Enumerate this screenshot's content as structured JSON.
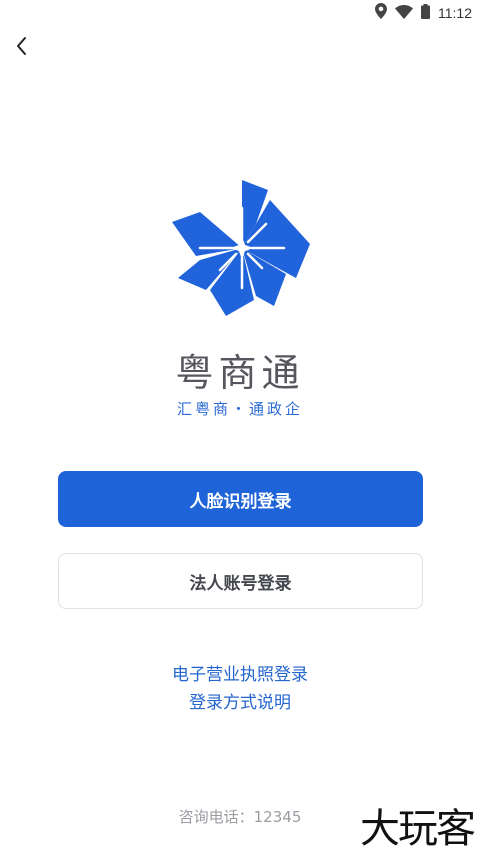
{
  "status_bar": {
    "time": "11:12",
    "icons": [
      "location-icon",
      "wifi-icon",
      "battery-icon"
    ]
  },
  "nav": {
    "back_icon": "chevron-left-icon"
  },
  "brand": {
    "app_name": "粤商通",
    "slogan": "汇粤商・通政企",
    "logo_color": "#2063db"
  },
  "buttons": {
    "face_login": "人脸识别登录",
    "account_login": "法人账号登录"
  },
  "links": {
    "license_login": "电子营业执照登录",
    "login_help": "登录方式说明"
  },
  "footer": {
    "hotline": "咨询电话：12345",
    "watermark": "大玩客"
  },
  "colors": {
    "primary": "#1f63d8",
    "link": "#2465cf",
    "text_dark": "#45474e"
  }
}
